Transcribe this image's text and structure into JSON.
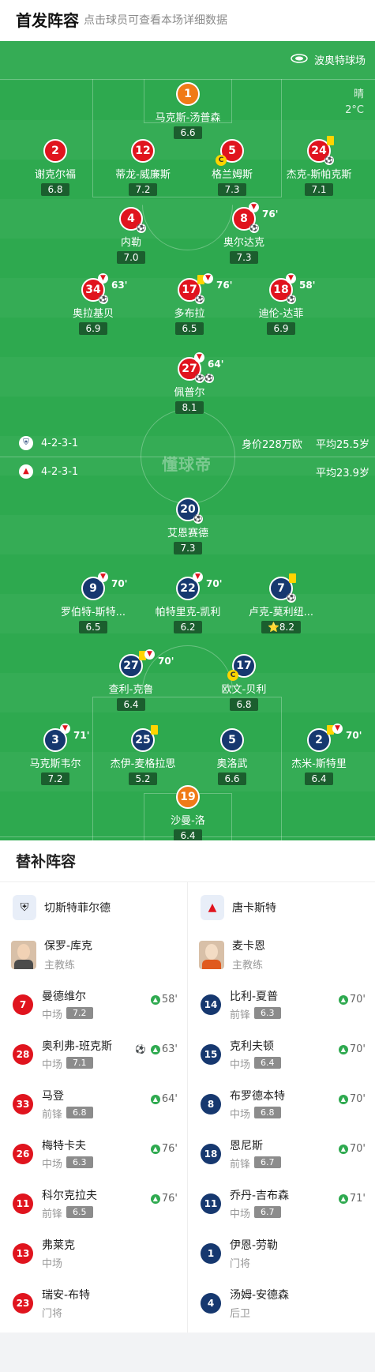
{
  "header": {
    "title": "首发阵容",
    "subtitle": "点击球员可查看本场详细数据"
  },
  "field": {
    "venue": "波奥特球场",
    "weather": "晴",
    "temperature": "2°C",
    "watermark": "懂球帝",
    "home": {
      "formation": "4-2-3-1",
      "value": "身价228万欧",
      "avg_age": "平均25.5岁",
      "players": [
        {
          "num": "1",
          "name": "马克斯-汤普森",
          "rating": "6.6",
          "type": "gk"
        },
        {
          "num": "2",
          "name": "谢克尔福",
          "rating": "6.8"
        },
        {
          "num": "12",
          "name": "蒂龙-威廉斯",
          "rating": "7.2"
        },
        {
          "num": "5",
          "name": "格兰姆斯",
          "rating": "7.3",
          "captain": "C"
        },
        {
          "num": "24",
          "name": "杰克-斯帕克斯",
          "rating": "7.1"
        },
        {
          "num": "4",
          "name": "内勒",
          "rating": "7.0"
        },
        {
          "num": "8",
          "name": "奥尔达克",
          "rating": "7.3",
          "sub_min": "76'"
        },
        {
          "num": "34",
          "name": "奥拉基贝",
          "rating": "6.9",
          "sub_min": "63'"
        },
        {
          "num": "17",
          "name": "多布拉",
          "rating": "6.5",
          "sub_min": "76'"
        },
        {
          "num": "18",
          "name": "迪伦-达菲",
          "rating": "6.9",
          "sub_min": "58'"
        },
        {
          "num": "27",
          "name": "佩普尔",
          "rating": "8.1",
          "sub_min": "64'"
        }
      ]
    },
    "away": {
      "formation": "4-2-3-1",
      "avg_age": "平均23.9岁",
      "players": [
        {
          "num": "20",
          "name": "艾恩赛德",
          "rating": "7.3"
        },
        {
          "num": "9",
          "name": "罗伯特-斯特...",
          "rating": "6.5",
          "sub_min": "70'"
        },
        {
          "num": "22",
          "name": "帕特里克-凯利",
          "rating": "6.2",
          "sub_min": "70'"
        },
        {
          "num": "7",
          "name": "卢克-莫利纽...",
          "rating": "8.2"
        },
        {
          "num": "27",
          "name": "查利-克鲁",
          "rating": "6.4",
          "sub_min": "70'"
        },
        {
          "num": "17",
          "name": "欧文-贝利",
          "rating": "6.8",
          "captain": "C"
        },
        {
          "num": "3",
          "name": "马克斯韦尔",
          "rating": "7.2",
          "sub_min": "71'"
        },
        {
          "num": "25",
          "name": "杰伊-麦格拉思",
          "rating": "5.2"
        },
        {
          "num": "5",
          "name": "奥洛武",
          "rating": "6.6"
        },
        {
          "num": "2",
          "name": "杰米-斯特里",
          "rating": "6.4",
          "sub_min": "70'"
        },
        {
          "num": "19",
          "name": "沙曼-洛",
          "rating": "6.4",
          "type": "gk"
        }
      ]
    }
  },
  "subs": {
    "title": "替补阵容",
    "home": {
      "team": "切斯特菲尔德",
      "coach": {
        "name": "保罗-库克",
        "role": "主教练"
      },
      "players": [
        {
          "num": "7",
          "name": "曼德维尔",
          "pos": "中场",
          "rating": "7.2",
          "in": "58'"
        },
        {
          "num": "28",
          "name": "奥利弗-班克斯",
          "pos": "中场",
          "rating": "7.1",
          "in": "63'",
          "goal": true
        },
        {
          "num": "33",
          "name": "马登",
          "pos": "前锋",
          "rating": "6.8",
          "in": "64'"
        },
        {
          "num": "26",
          "name": "梅特卡夫",
          "pos": "中场",
          "rating": "6.3",
          "in": "76'"
        },
        {
          "num": "11",
          "name": "科尔克拉夫",
          "pos": "前锋",
          "rating": "6.5",
          "in": "76'"
        },
        {
          "num": "13",
          "name": "弗莱克",
          "pos": "中场"
        },
        {
          "num": "23",
          "name": "瑞安-布特",
          "pos": "门将"
        }
      ]
    },
    "away": {
      "team": "唐卡斯特",
      "coach": {
        "name": "麦卡恩",
        "role": "主教练"
      },
      "players": [
        {
          "num": "14",
          "name": "比利-夏普",
          "pos": "前锋",
          "rating": "6.3",
          "in": "70'"
        },
        {
          "num": "15",
          "name": "克利夫顿",
          "pos": "中场",
          "rating": "6.4",
          "in": "70'"
        },
        {
          "num": "8",
          "name": "布罗德本特",
          "pos": "中场",
          "rating": "6.8",
          "in": "70'"
        },
        {
          "num": "18",
          "name": "恩尼斯",
          "pos": "前锋",
          "rating": "6.7",
          "in": "70'"
        },
        {
          "num": "11",
          "name": "乔丹-吉布森",
          "pos": "中场",
          "rating": "6.7",
          "in": "71'"
        },
        {
          "num": "1",
          "name": "伊恩-劳勒",
          "pos": "门将"
        },
        {
          "num": "4",
          "name": "汤姆-安德森",
          "pos": "后卫"
        }
      ]
    }
  }
}
